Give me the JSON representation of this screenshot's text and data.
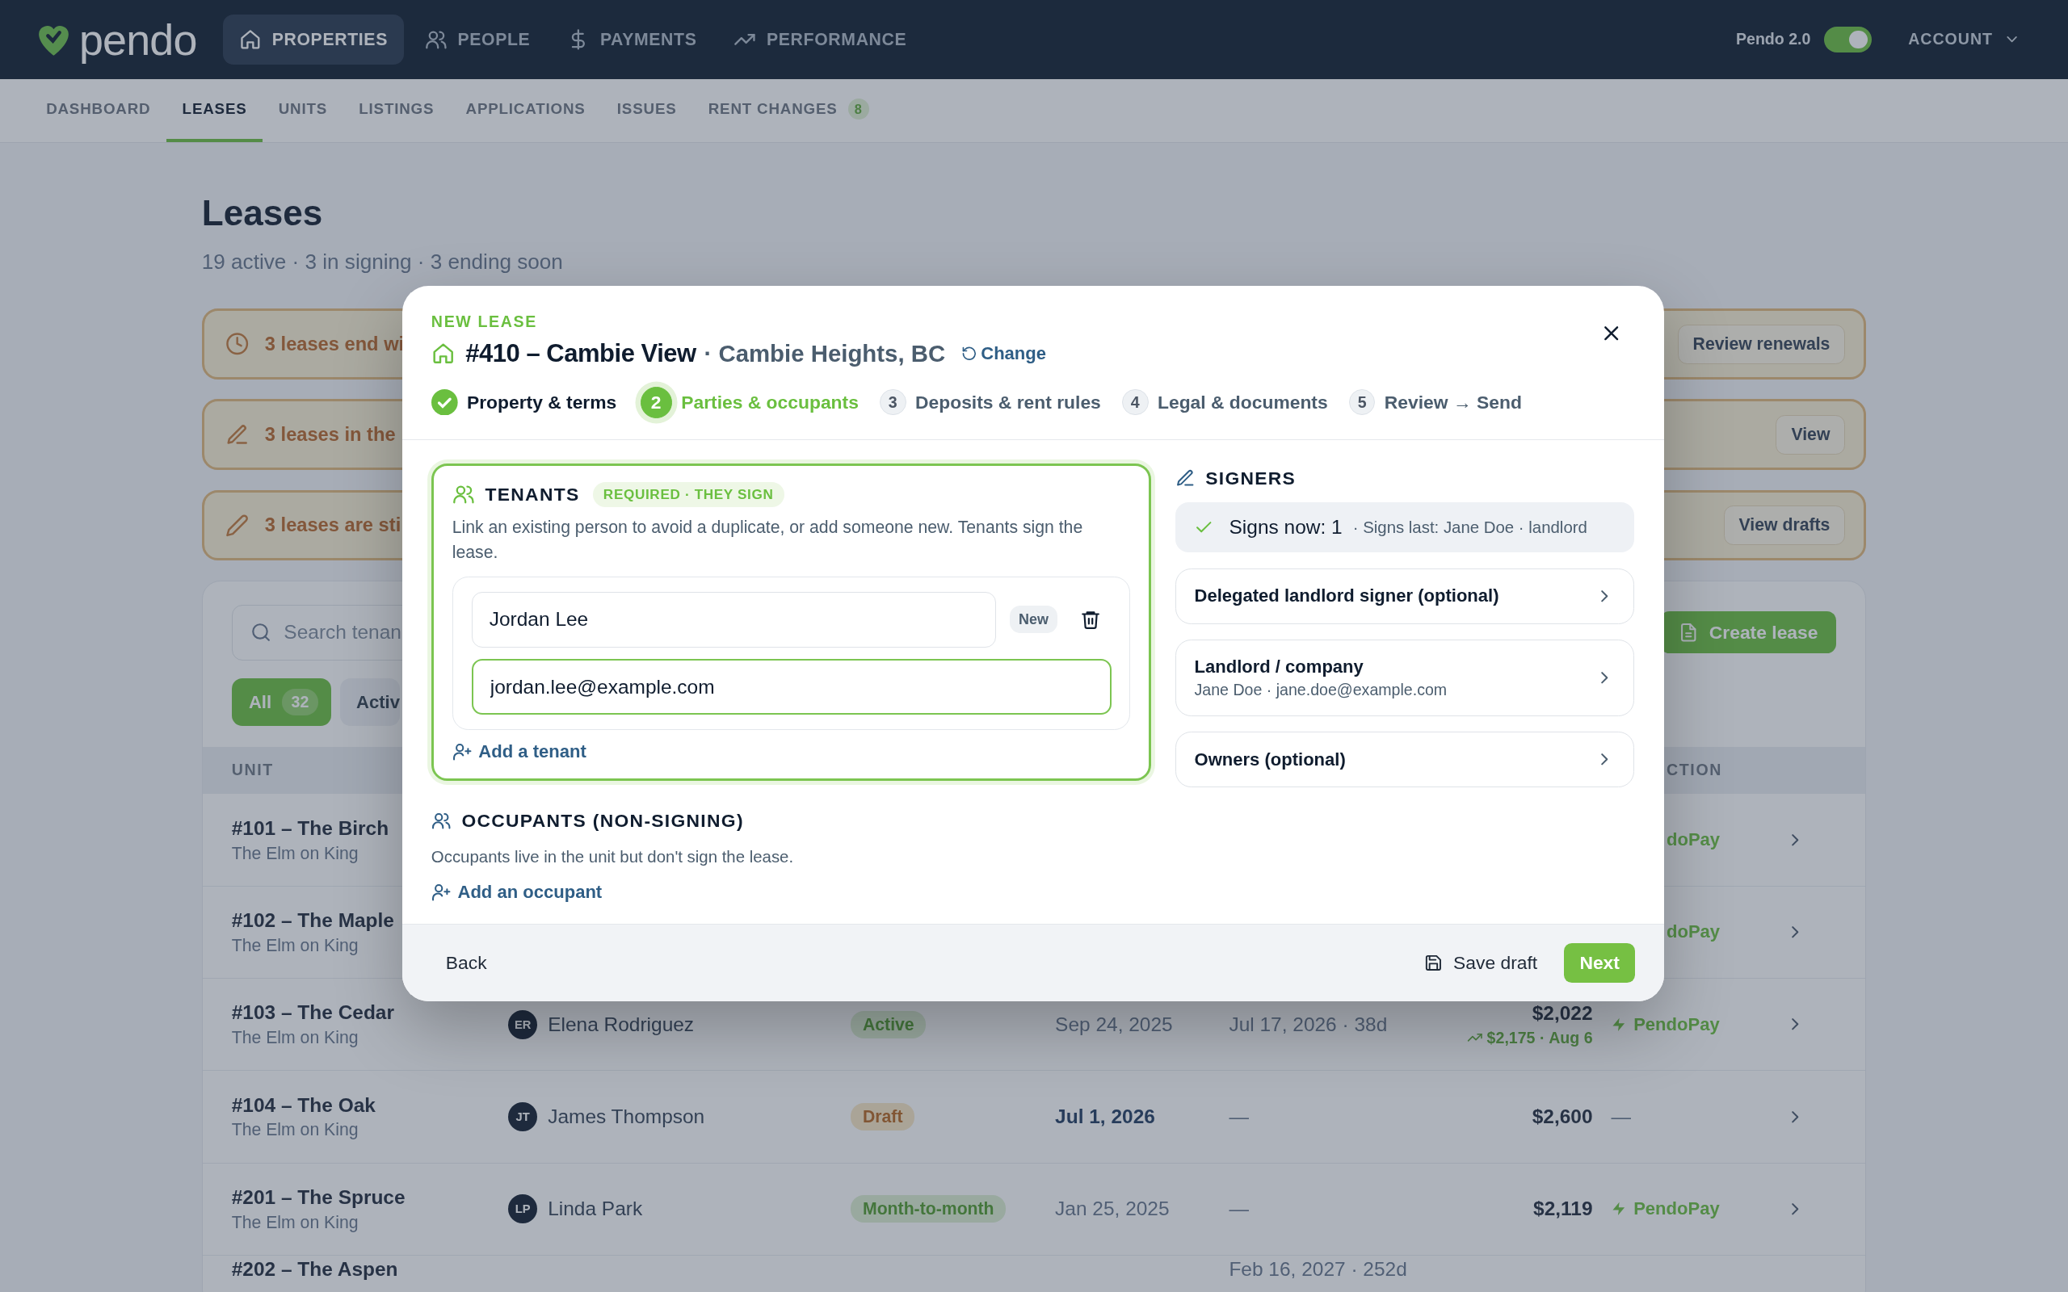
{
  "top_nav": {
    "logo": "pendo",
    "items": [
      {
        "label": "PROPERTIES",
        "selected": true
      },
      {
        "label": "PEOPLE",
        "selected": false
      },
      {
        "label": "PAYMENTS",
        "selected": false
      },
      {
        "label": "PERFORMANCE",
        "selected": false
      }
    ],
    "version_toggle": {
      "label": "Pendo 2.0",
      "on": true
    },
    "account": "ACCOUNT"
  },
  "sub_nav": [
    {
      "label": "DASHBOARD",
      "selected": false
    },
    {
      "label": "LEASES",
      "selected": true
    },
    {
      "label": "UNITS",
      "selected": false
    },
    {
      "label": "LISTINGS",
      "selected": false
    },
    {
      "label": "APPLICATIONS",
      "selected": false
    },
    {
      "label": "ISSUES",
      "selected": false
    },
    {
      "label": "RENT CHANGES",
      "selected": false,
      "badge": "8"
    }
  ],
  "page": {
    "title": "Leases",
    "subtitle": "19 active · 3 in signing · 3 ending soon"
  },
  "alerts": [
    {
      "text": "3 leases end wi",
      "action": "Review renewals"
    },
    {
      "text": "3 leases in the",
      "action": "View"
    },
    {
      "text": "3 leases are sti",
      "action": "View drafts"
    }
  ],
  "table_card": {
    "search": {
      "placeholder": "Search tenan"
    },
    "create_button": "Create lease",
    "filters": [
      {
        "label": "All",
        "count": "32",
        "selected": true
      },
      {
        "label": "Activ",
        "selected": false
      }
    ],
    "columns": [
      {
        "label": "UNIT"
      },
      {
        "label": "CTION"
      }
    ],
    "rows": [
      {
        "unit": "#101 – The Birch",
        "property": "The Elm on King",
        "payment": {
          "kind": "partial",
          "text": "doPay"
        }
      },
      {
        "unit": "#102 – The Maple",
        "property": "The Elm on King",
        "payment": {
          "kind": "partial",
          "text": "doPay"
        }
      },
      {
        "unit": "#103 – The Cedar",
        "property": "The Elm on King",
        "tenant": {
          "initials": "ER",
          "name": "Elena Rodriguez"
        },
        "status": {
          "label": "Active",
          "kind": "positive"
        },
        "start": "Sep 24, 2025",
        "start_emphasized": false,
        "end": "Jul 17, 2026 · 38d",
        "rent": "$2,022",
        "rent_change": "$2,175 · Aug 6",
        "payment": {
          "kind": "pendopay",
          "text": "PendoPay"
        }
      },
      {
        "unit": "#104 – The Oak",
        "property": "The Elm on King",
        "tenant": {
          "initials": "JT",
          "name": "James Thompson"
        },
        "status": {
          "label": "Draft",
          "kind": "warning"
        },
        "start": "Jul 1, 2026",
        "start_emphasized": true,
        "end": "—",
        "rent": "$2,600",
        "payment": {
          "kind": "none",
          "text": "—"
        }
      },
      {
        "unit": "#201 – The Spruce",
        "property": "The Elm on King",
        "tenant": {
          "initials": "LP",
          "name": "Linda Park"
        },
        "status": {
          "label": "Month-to-month",
          "kind": "positive"
        },
        "start": "Jan 25, 2025",
        "start_emphasized": false,
        "end": "—",
        "rent": "$2,119",
        "payment": {
          "kind": "pendopay",
          "text": "PendoPay"
        }
      },
      {
        "unit": "#202 – The Aspen",
        "end": "Feb 16, 2027 · 252d"
      }
    ]
  },
  "modal": {
    "eyebrow": "NEW LEASE",
    "title": "#410 – Cambie View",
    "location": "· Cambie Heights, BC",
    "change": "Change",
    "steps": [
      {
        "label": "Property & terms",
        "done": true,
        "selected": false
      },
      {
        "number": "2",
        "label": "Parties & occupants",
        "done": false,
        "selected": true
      },
      {
        "number": "3",
        "label": "Deposits & rent rules",
        "done": false,
        "selected": false
      },
      {
        "number": "4",
        "label": "Legal & documents",
        "done": false,
        "selected": false
      },
      {
        "number": "5",
        "label": "Review → Send",
        "done": false,
        "selected": false
      }
    ],
    "tenants": {
      "title": "TENANTS",
      "badge": "REQUIRED · THEY SIGN",
      "description": "Link an existing person to avoid a duplicate, or add someone new. Tenants sign the lease.",
      "entries": [
        {
          "name": "Jordan Lee",
          "name_focused": false,
          "badge": "New",
          "email": "jordan.lee@example.com",
          "email_focused": true
        }
      ],
      "add": "Add a tenant"
    },
    "occupants": {
      "title": "OCCUPANTS (NON-SIGNING)",
      "description": "Occupants live in the unit but don't sign the lease.",
      "add": "Add an occupant"
    },
    "signers": {
      "title": "SIGNERS",
      "summary": "Signs now: 1",
      "summary_detail": "· Signs last: Jane Doe · landlord",
      "items": [
        {
          "title": "Delegated landlord signer (optional)"
        },
        {
          "title": "Landlord / company",
          "detail": "Jane Doe · jane.doe@example.com"
        },
        {
          "title": "Owners (optional)"
        }
      ]
    },
    "footer": {
      "back": "Back",
      "save": "Save draft",
      "next": "Next"
    }
  }
}
